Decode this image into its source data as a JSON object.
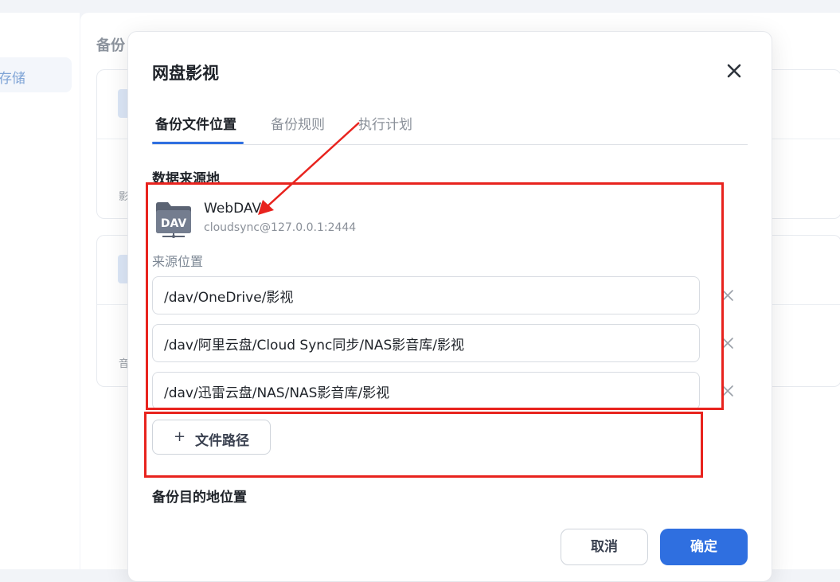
{
  "background": {
    "sidebar_item": "存储",
    "heading": "备份",
    "card1_text": "影",
    "card2_text": "音"
  },
  "dialog": {
    "title": "网盘影视",
    "close_icon": "close-icon",
    "tabs": [
      {
        "label": "备份文件位置",
        "active": true
      },
      {
        "label": "备份规则",
        "active": false
      },
      {
        "label": "执行计划",
        "active": false
      }
    ],
    "source_section_label": "数据来源地",
    "source": {
      "icon_text": "DAV",
      "name": "WebDAV",
      "account": "cloudsync@127.0.0.1:2444"
    },
    "source_location_label": "来源位置",
    "paths": [
      "/dav/OneDrive/影视",
      "/dav/阿里云盘/Cloud Sync同步/NAS影音库/影视",
      "/dav/迅雷云盘/NAS/NAS影音库/影视"
    ],
    "add_path_label": "文件路径",
    "add_path_symbol": "+",
    "destination_section_label": "备份目的地位置",
    "cancel_label": "取消",
    "ok_label": "确定"
  },
  "colors": {
    "accent": "#2f6fe0",
    "annotation": "#e8231e",
    "muted_text": "#8a9099"
  }
}
